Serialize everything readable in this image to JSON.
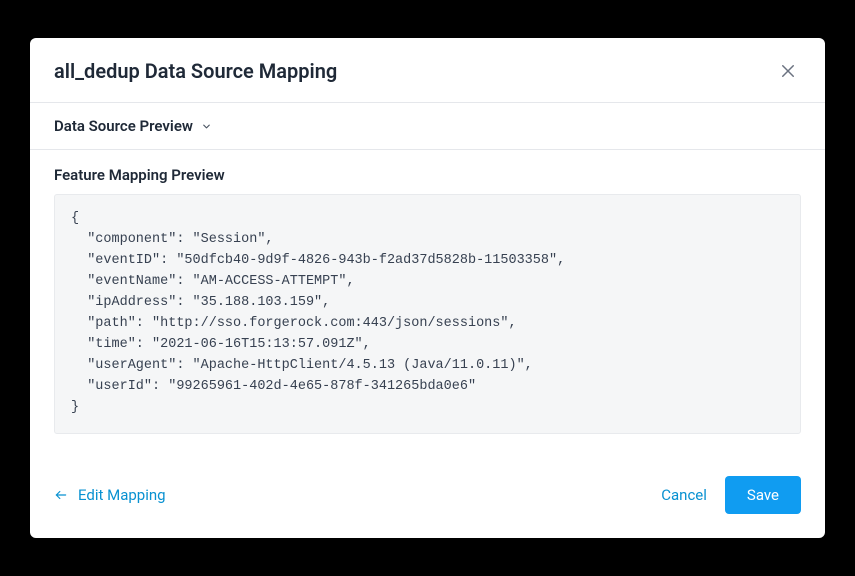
{
  "modal": {
    "title": "all_dedup Data Source Mapping",
    "data_source_preview_label": "Data Source Preview",
    "feature_mapping_preview_label": "Feature Mapping Preview"
  },
  "preview_json": {
    "component": "Session",
    "eventID": "50dfcb40-9d9f-4826-943b-f2ad37d5828b-11503358",
    "eventName": "AM-ACCESS-ATTEMPT",
    "ipAddress": "35.188.103.159",
    "path": "http://sso.forgerock.com:443/json/sessions",
    "time": "2021-06-16T15:13:57.091Z",
    "userAgent": "Apache-HttpClient/4.5.13 (Java/11.0.11)",
    "userId": "99265961-402d-4e65-878f-341265bda0e6"
  },
  "footer": {
    "edit_mapping_label": "Edit Mapping",
    "cancel_label": "Cancel",
    "save_label": "Save"
  }
}
